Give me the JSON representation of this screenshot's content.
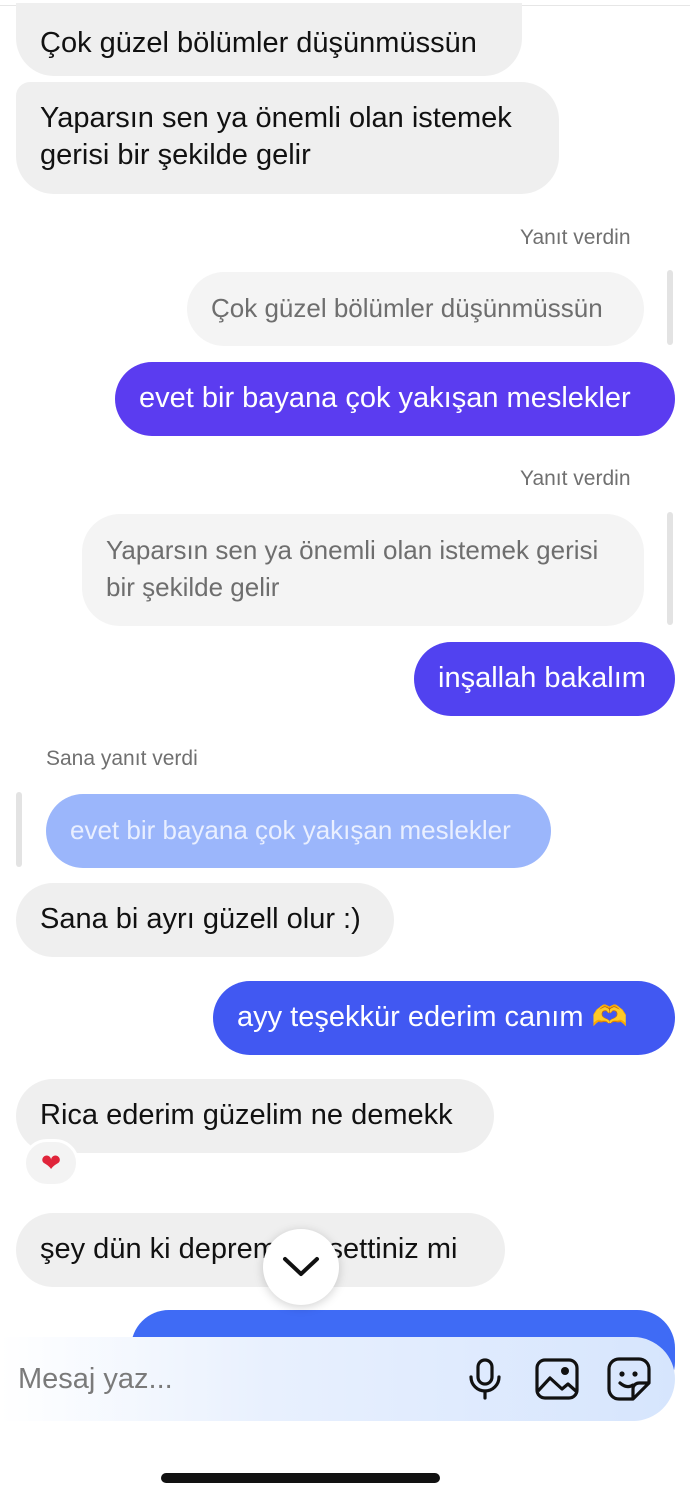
{
  "messages": {
    "m1": "Çok güzel bölümler düşünmüssün",
    "m2_line1": "Yaparsın sen ya önemli olan istemek",
    "m2_line2": "gerisi bir şekilde gelir",
    "reply_label_1": "Yanıt verdin",
    "quote_1": "Çok güzel bölümler düşünmüssün",
    "out_1": "evet bir bayana çok yakışan meslekler",
    "reply_label_2": "Yanıt verdin",
    "quote_2_line1": "Yaparsın sen ya önemli olan istemek gerisi",
    "quote_2_line2": "bir şekilde gelir",
    "out_2": "inşallah bakalım",
    "reply_label_3": "Sana yanıt verdi",
    "quote_3": "evet bir bayana çok yakışan meslekler",
    "in_3": "Sana bi ayrı güzell olur :)",
    "out_3": "ayy teşekkür ederim canım 🫶",
    "in_4": "Rica ederim güzelim ne demekk",
    "reaction_4": "❤",
    "in_5": "şey dün ki depremi hissettiniz mi"
  },
  "composer": {
    "placeholder": "Mesaj yaz..."
  },
  "icons": {
    "mic": "microphone-icon",
    "gallery": "image-gallery-icon",
    "sticker": "sticker-icon",
    "scroll": "chevron-down-icon"
  },
  "colors": {
    "incoming_bubble": "#efefef",
    "outgoing_top": "#5b3cf0",
    "outgoing_bottom": "#3f6bf5",
    "reaction_heart": "#e0243a"
  }
}
